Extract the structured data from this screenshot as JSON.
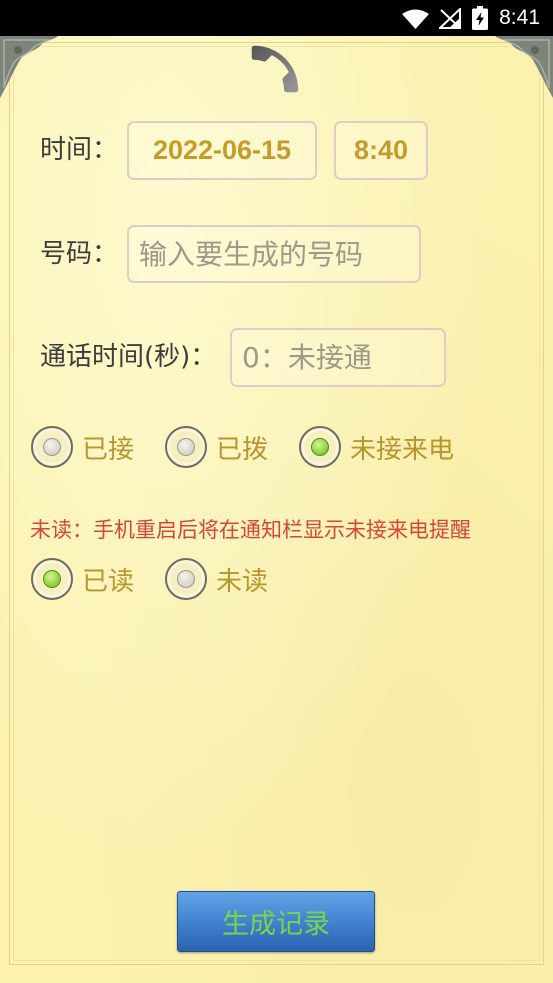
{
  "status_bar": {
    "time": "8:41",
    "icons": [
      "wifi-icon",
      "no-sim-signal-icon",
      "battery-charging-icon"
    ]
  },
  "header": {
    "icon": "phone-handset-icon",
    "decorations": [
      "corner-ornament-left",
      "corner-ornament-right"
    ]
  },
  "form": {
    "time_row": {
      "label": "时间：",
      "date_value": "2022-06-15",
      "time_value": "8:40"
    },
    "number_row": {
      "label": "号码：",
      "placeholder": "输入要生成的号码"
    },
    "duration_row": {
      "label": "通话时间(秒)：",
      "placeholder": "0：未接通"
    },
    "call_type": {
      "options": [
        {
          "label": "已接",
          "selected": false
        },
        {
          "label": "已拨",
          "selected": false
        },
        {
          "label": "未接来电",
          "selected": true
        }
      ]
    },
    "unread_notice": "未读：手机重启后将在通知栏显示未接来电提醒",
    "read_status": {
      "options": [
        {
          "label": "已读",
          "selected": true
        },
        {
          "label": "未读",
          "selected": false
        }
      ]
    },
    "generate_button": "生成记录"
  },
  "colors": {
    "status_bar_bg": "#000000",
    "paper": "#fbf2b0",
    "label_text": "#3c3c3c",
    "accent_gold": "#c59b2e",
    "field_border": "#e1cbc6",
    "placeholder": "#9d9a8a",
    "radio_label": "#b8952e",
    "radio_selected": "#6cb81c",
    "notice_red": "#d6463c",
    "button_blue": "#3f7fd0",
    "button_text": "#7ad443"
  }
}
